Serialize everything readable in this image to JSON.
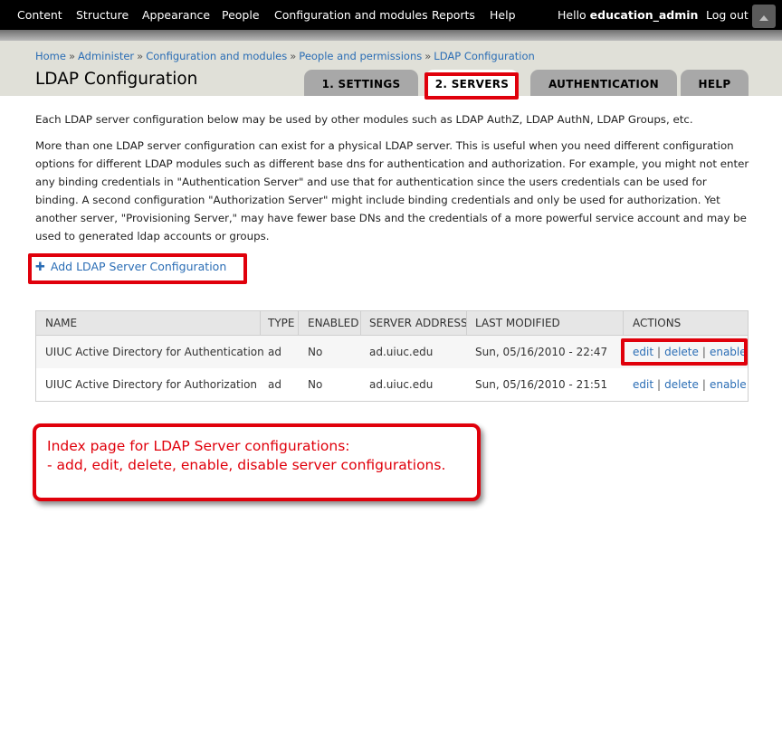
{
  "toolbar": {
    "menu": [
      "Content",
      "Structure",
      "Appearance",
      "People",
      "Configuration and modules",
      "Reports",
      "Help"
    ],
    "hello_prefix": "Hello ",
    "username": "education_admin",
    "logout": "Log out"
  },
  "breadcrumb": [
    "Home",
    "Administer",
    "Configuration and modules",
    "People and permissions",
    "LDAP Configuration"
  ],
  "breadcrumb_sep": "»",
  "page_title": "LDAP Configuration",
  "tabs": [
    "1. SETTINGS",
    "2. SERVERS",
    "AUTHENTICATION",
    "HELP"
  ],
  "active_tab": "2. SERVERS",
  "intro": "Each LDAP server configuration below may be used by other modules such as LDAP AuthZ, LDAP AuthN, LDAP Groups, etc.",
  "description": "More than one LDAP server configuration can exist for a physical LDAP server. This is useful when you need different configuration options for different LDAP modules such as different base dns for authentication and authorization. For example, you might not enter any binding credentials in \"Authentication Server\" and use that for authentication since the users credentials can be used for binding. A second configuration \"Authorization Server\" might include binding credentials and only be used for authorization. Yet another server, \"Provisioning Server,\" may have fewer base DNs and the credentials of a more powerful service account and may be used to generated ldap accounts or groups.",
  "add_link": "Add LDAP Server Configuration",
  "table": {
    "headers": [
      "NAME",
      "TYPE",
      "ENABLED",
      "SERVER ADDRESS",
      "LAST MODIFIED",
      "ACTIONS"
    ],
    "rows": [
      {
        "name": "UIUC Active Directory for Authentication",
        "type": "ad",
        "enabled": "No",
        "address": "ad.uiuc.edu",
        "modified": "Sun, 05/16/2010 - 22:47",
        "actions": [
          "edit",
          "delete",
          "enable"
        ]
      },
      {
        "name": "UIUC Active Directory for Authorization",
        "type": "ad",
        "enabled": "No",
        "address": "ad.uiuc.edu",
        "modified": "Sun, 05/16/2010 - 21:51",
        "actions": [
          "edit",
          "delete",
          "enable"
        ]
      }
    ]
  },
  "callout": {
    "line1": "Index page for LDAP Server configurations:",
    "line2": "- add, edit, delete, enable, disable server configurations."
  },
  "colors": {
    "accent_red": "#e0000b",
    "link_blue": "#2a6db5",
    "toolbar": "#000000"
  }
}
